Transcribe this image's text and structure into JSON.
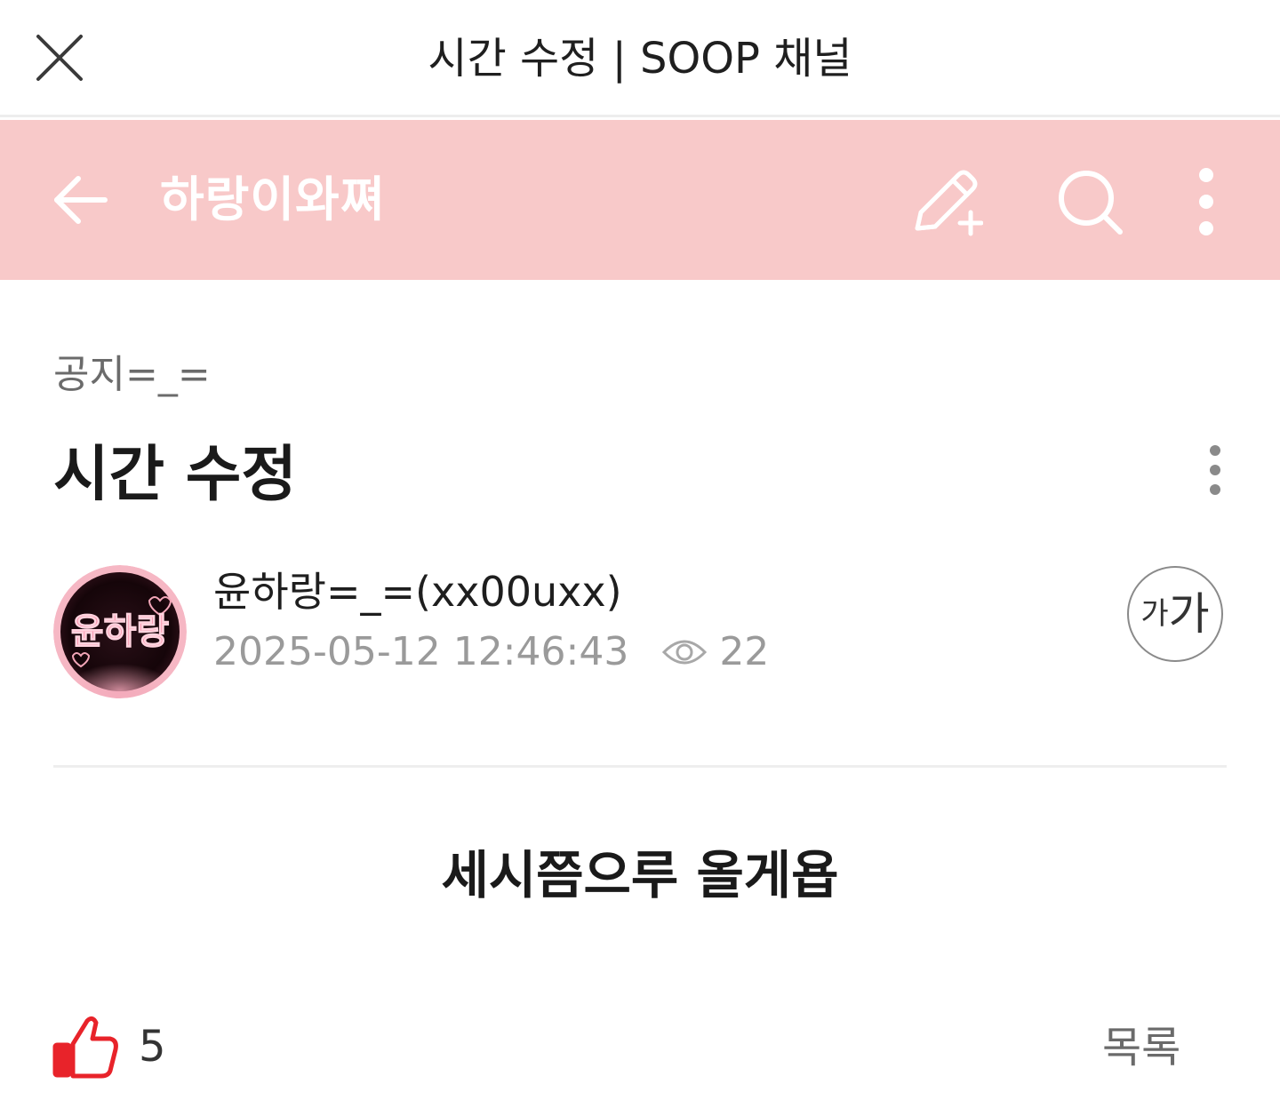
{
  "browser_bar": {
    "title": "시간 수정 | SOOP 채널",
    "close_icon": "close-icon"
  },
  "header": {
    "channel_title": "하랑이와쪄",
    "background_color": "#f8c9c9",
    "icons": [
      "back-arrow-icon",
      "write-pencil-icon",
      "search-icon",
      "more-vertical-icon"
    ]
  },
  "post": {
    "category": "공지=_=",
    "title": "시간 수정",
    "author": {
      "display": "윤하랑=_=(xx00uxx)",
      "avatar_text": "윤하랑"
    },
    "date": "2025-05-12 12:46:43",
    "views": "22",
    "font_size_button": {
      "small": "가",
      "big": "가"
    },
    "body": "세시쯤으루 올게욥"
  },
  "footer": {
    "like_count": "5",
    "like_color": "#e8232a",
    "list_label": "목록"
  }
}
